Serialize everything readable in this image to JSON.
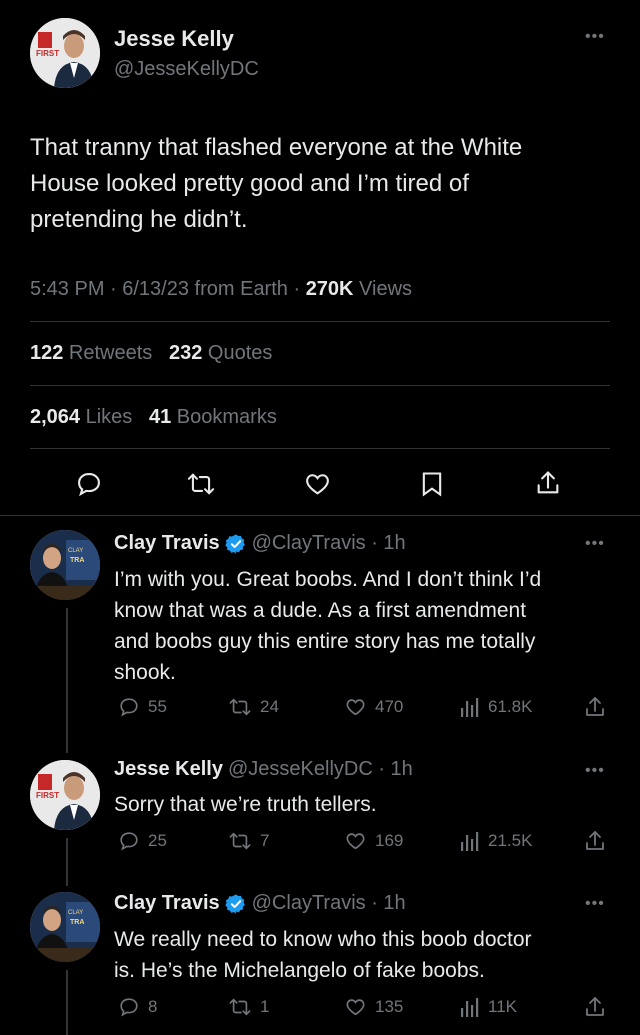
{
  "main_tweet": {
    "author_name": "Jesse Kelly",
    "author_handle": "@JesseKellyDC",
    "avatar_badge": "FIRST",
    "text_lines": [
      "That tranny that flashed everyone at the White",
      "House looked pretty good and I’m tired of",
      "pretending he didn’t."
    ],
    "meta_time": "5:43 PM · 6/13/23 from Earth · ",
    "views_count": "270K",
    "views_label": " Views",
    "retweets_count": "122",
    "retweets_label": " Retweets",
    "quotes_count": "232",
    "quotes_label": " Quotes",
    "likes_count": "2,064",
    "likes_label": " Likes",
    "bookmarks_count": "41",
    "bookmarks_label": " Bookmarks"
  },
  "replies": [
    {
      "author_name": "Clay Travis",
      "author_handle": "@ClayTravis · 1h",
      "verified": true,
      "text_lines": [
        "I’m with you. Great boobs. And I don’t think I’d",
        "know that was a dude. As a first amendment",
        "and boobs guy this entire story has me totally",
        "shook."
      ],
      "replies": "55",
      "retweets": "24",
      "likes": "470",
      "views": "61.8K"
    },
    {
      "author_name": "Jesse Kelly",
      "author_handle": "@JesseKellyDC · 1h",
      "verified": false,
      "text_lines": [
        "Sorry that we’re truth tellers."
      ],
      "replies": "25",
      "retweets": "7",
      "likes": "169",
      "views": "21.5K"
    },
    {
      "author_name": "Clay Travis",
      "author_handle": "@ClayTravis · 1h",
      "verified": true,
      "text_lines": [
        "We really need to know who this boob doctor",
        "is. He’s the Michelangelo of fake boobs."
      ],
      "replies": "8",
      "retweets": "1",
      "likes": "135",
      "views": "11K"
    }
  ],
  "colors": {
    "background": "#000000",
    "text": "#e7e9ea",
    "muted": "#71767b",
    "verified": "#1d9bf0",
    "divider": "#2f3336"
  },
  "icons": [
    "reply-icon",
    "retweet-icon",
    "like-icon",
    "bookmark-icon",
    "share-icon",
    "views-icon",
    "verified-badge-icon",
    "more-icon"
  ]
}
